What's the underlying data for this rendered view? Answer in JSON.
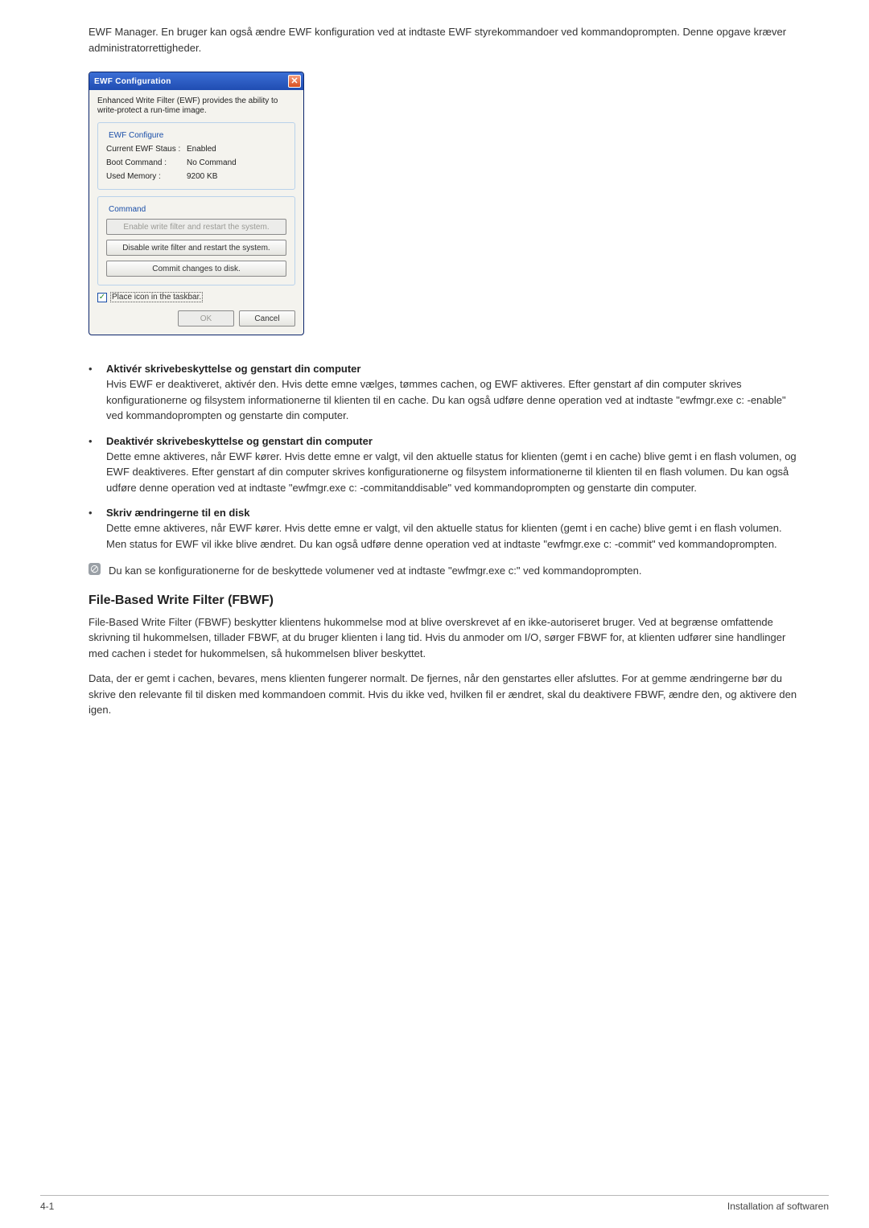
{
  "intro": "EWF Manager. En bruger kan også ændre EWF konfiguration ved at indtaste EWF styrekommandoer ved kommandoprompten. Denne opgave kræver administratorrettigheder.",
  "dialog": {
    "title": "EWF Configuration",
    "description": "Enhanced Write Filter (EWF) provides the ability to write-protect a run-time image.",
    "group1": {
      "legend": "EWF Configure",
      "status_label": "Current EWF Staus :",
      "status_value": "Enabled",
      "boot_label": "Boot Command :",
      "boot_value": "No Command",
      "mem_label": "Used Memory :",
      "mem_value": "9200 KB"
    },
    "group2": {
      "legend": "Command",
      "btn_enable": "Enable write filter and restart the system.",
      "btn_disable": "Disable write filter and restart the system.",
      "btn_commit": "Commit changes to disk."
    },
    "checkbox_label": "Place icon in the taskbar.",
    "ok": "OK",
    "cancel": "Cancel"
  },
  "bullets": {
    "b1_title": "Aktivér skrivebeskyttelse og genstart din computer",
    "b1_body": "Hvis EWF er deaktiveret, aktivér den. Hvis dette emne vælges, tømmes cachen, og EWF aktiveres. Efter genstart af din computer skrives konfigurationerne og filsystem informationerne til klienten til en cache. Du kan også udføre denne operation ved at indtaste \"ewfmgr.exe c: -enable\" ved kommandoprompten og genstarte din computer.",
    "b2_title": "Deaktivér skrivebeskyttelse og genstart din computer",
    "b2_body": "Dette emne aktiveres, når EWF kører. Hvis dette emne er valgt, vil den aktuelle status for klienten (gemt i en cache) blive gemt i en flash volumen, og EWF deaktiveres. Efter genstart af din computer skrives konfigurationerne og filsystem informationerne til klienten til en flash volumen. Du kan også udføre denne operation ved at indtaste \"ewfmgr.exe c: -commitanddisable\" ved kommandoprompten og genstarte din computer.",
    "b3_title": "Skriv ændringerne til en disk",
    "b3_body": "Dette emne aktiveres, når EWF kører. Hvis dette emne er valgt, vil den aktuelle status for klienten (gemt i en cache) blive gemt i en flash volumen. Men status for EWF vil ikke blive ændret. Du kan også udføre denne operation ved at indtaste \"ewfmgr.exe c: -commit\" ved kommandoprompten."
  },
  "note": "Du kan se konfigurationerne for de beskyttede volumener ved at indtaste \"ewfmgr.exe c:\" ved kommandoprompten.",
  "fbwf": {
    "heading": "File-Based Write Filter (FBWF)",
    "p1": "File-Based Write Filter (FBWF) beskytter klientens hukommelse mod at blive overskrevet af en ikke-autoriseret bruger. Ved at begrænse omfattende skrivning til hukommelsen, tillader FBWF, at du bruger klienten i lang tid. Hvis du anmoder om I/O, sørger FBWF for, at klienten udfører sine handlinger med cachen i stedet for hukommelsen, så hukommelsen bliver beskyttet.",
    "p2": "Data, der er gemt i cachen, bevares, mens klienten fungerer normalt. De fjernes, når den genstartes eller afsluttes. For at gemme ændringerne bør du skrive den relevante fil til disken med kommandoen commit. Hvis du ikke ved, hvilken fil er ændret, skal du deaktivere FBWF, ændre den, og aktivere den igen."
  },
  "footer": {
    "left": "4-1",
    "right": "Installation af softwaren"
  }
}
